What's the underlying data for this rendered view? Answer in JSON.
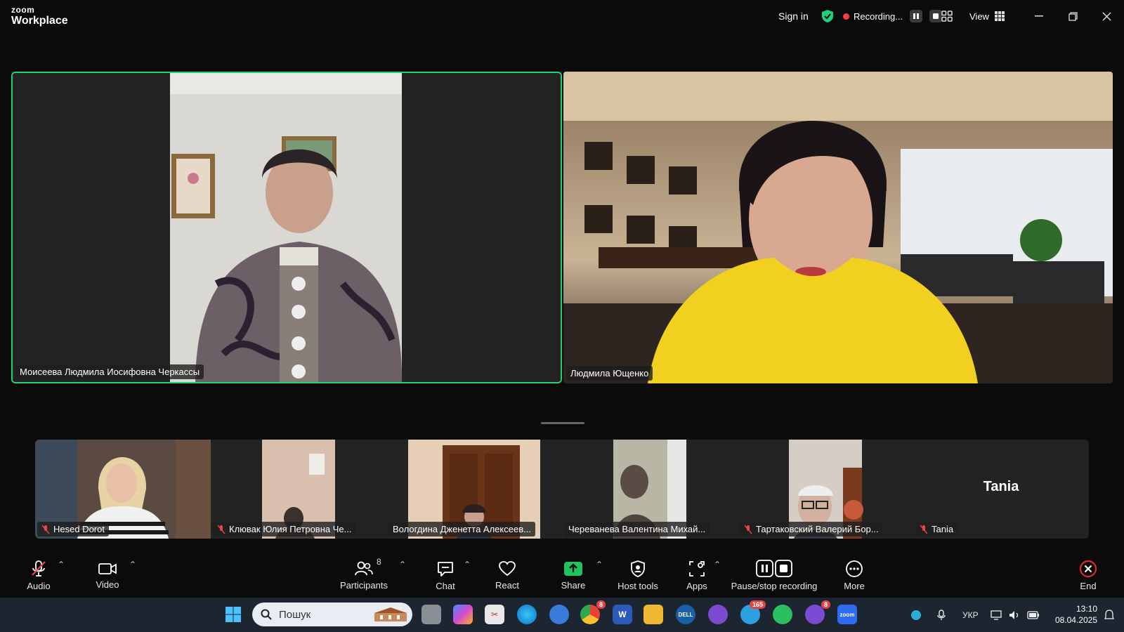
{
  "app": {
    "brand_top": "zoom",
    "brand_bottom": "Workplace"
  },
  "titlebar": {
    "sign_in": "Sign in",
    "recording": "Recording...",
    "view": "View"
  },
  "stage": {
    "left": {
      "name": "Моисеева Людмила Иосифовна Черкассы"
    },
    "right": {
      "name": "Людмила Ющенко"
    }
  },
  "gallery": [
    {
      "name": "Hesed Dorot",
      "muted": true
    },
    {
      "name": "Клювак Юлия Петровна Че...",
      "muted": true
    },
    {
      "name": "Вологдина Дженетта Алексеев...",
      "muted": false
    },
    {
      "name": "Череванева Валентина Михай...",
      "muted": false
    },
    {
      "name": "Тартаковский Валерий Бор...",
      "muted": true
    },
    {
      "name": "Tania",
      "muted": true,
      "big_label": "Tania"
    }
  ],
  "toolbar": {
    "audio": "Audio",
    "video": "Video",
    "participants": "Participants",
    "participants_count": "8",
    "chat": "Chat",
    "react": "React",
    "share": "Share",
    "host_tools": "Host tools",
    "apps": "Apps",
    "pause_stop": "Pause/stop recording",
    "more": "More",
    "end": "End"
  },
  "taskbar": {
    "search_placeholder": "Пошук",
    "chrome_badge": "8",
    "telegram_badge": "165",
    "viber_badge": "8",
    "lang": "УКР",
    "time": "13:10",
    "date": "08.04.2025"
  },
  "colors": {
    "active_speaker_border": "#1dd27a",
    "share_green": "#1fc45e",
    "end_red": "#e0282f",
    "recording_dot": "#ff3b3b"
  }
}
